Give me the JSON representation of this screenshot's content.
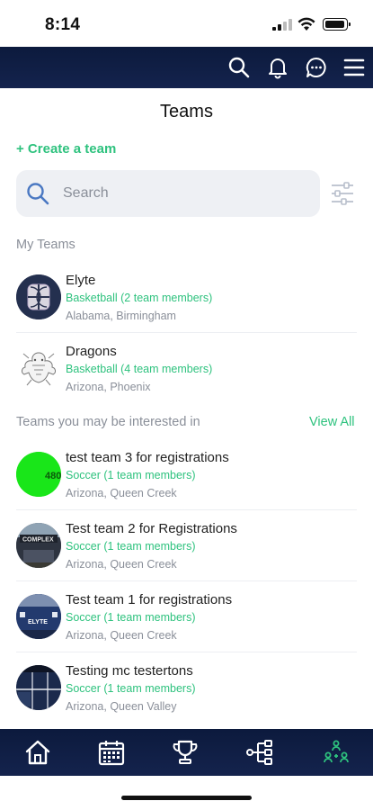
{
  "status_bar": {
    "time": "8:14"
  },
  "header": {
    "title": "Teams"
  },
  "actions": {
    "create_team": "+ Create a team"
  },
  "search": {
    "placeholder": "Search",
    "value": ""
  },
  "sections": {
    "my_teams": "My Teams",
    "interested": "Teams you may be interested in",
    "view_all": "View All"
  },
  "my_teams": [
    {
      "name": "Elyte",
      "sport": "Basketball (2 team members)",
      "location": "Alabama, Birmingham",
      "avatar": "elyte-logo"
    },
    {
      "name": "Dragons",
      "sport": "Basketball (4 team members)",
      "location": "Arizona, Phoenix",
      "avatar": "dragon-drawing"
    }
  ],
  "suggested_teams": [
    {
      "name": "test team 3 for registrations",
      "sport": "Soccer (1 team members)",
      "location": "Arizona, Queen Creek",
      "avatar": "green-480",
      "avatar_text": "480"
    },
    {
      "name": "Test team 2 for Registrations",
      "sport": "Soccer (1 team members)",
      "location": "Arizona, Queen Creek",
      "avatar": "complex-building",
      "avatar_text": "COMPLEX"
    },
    {
      "name": "Test team 1 for registrations",
      "sport": "Soccer (1 team members)",
      "location": "Arizona, Queen Creek",
      "avatar": "elyte-court",
      "avatar_text": "ELYTE"
    },
    {
      "name": "Testing mc testertons",
      "sport": "Soccer (1 team members)",
      "location": "Arizona, Queen Valley",
      "avatar": "court-photo"
    }
  ],
  "bottom_nav": [
    "home-icon",
    "calendar-icon",
    "trophy-icon",
    "bracket-icon",
    "teams-icon"
  ],
  "colors": {
    "nav_bg": "#0c1a3d",
    "accent_green": "#2ec27e",
    "muted_text": "#8a8f99",
    "search_bg": "#eef0f4"
  }
}
